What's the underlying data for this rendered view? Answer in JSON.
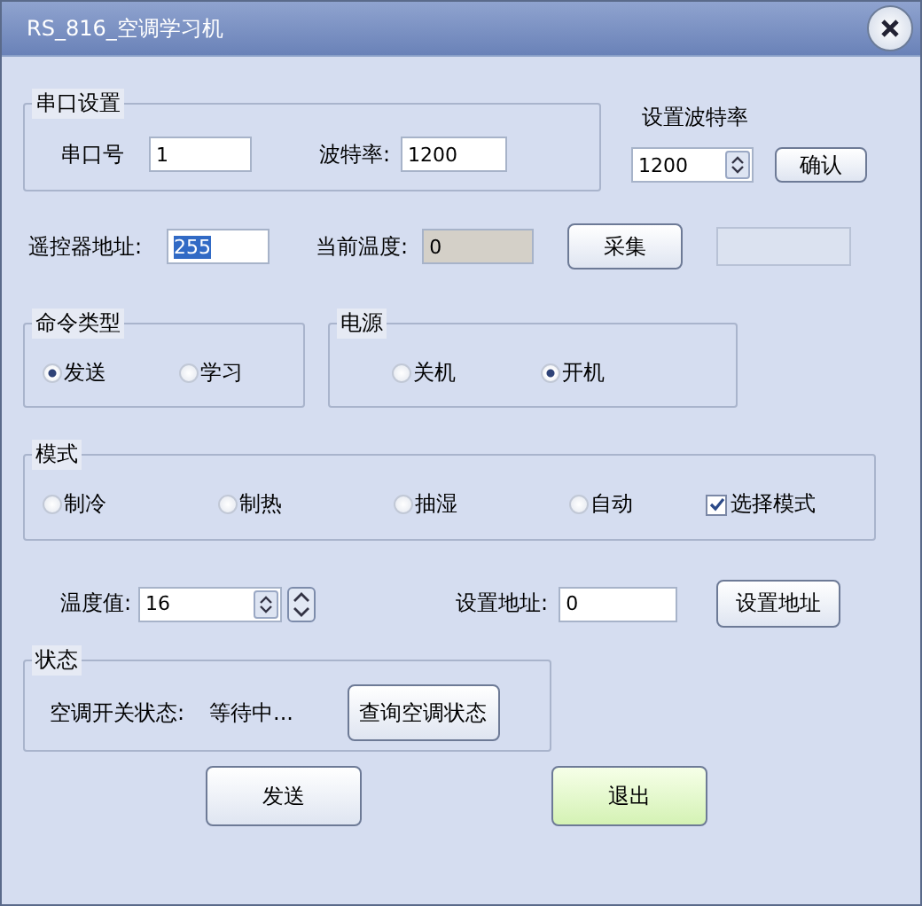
{
  "window": {
    "title": "RS_816_空调学习机"
  },
  "serial_settings": {
    "legend": "串口设置",
    "port_label": "串口号",
    "port_value": "1",
    "baud_label": "波特率:",
    "baud_value": "1200"
  },
  "baud_setting": {
    "label": "设置波特率",
    "value": "1200",
    "confirm_button": "确认"
  },
  "remote_address": {
    "label": "遥控器地址:",
    "value": "255",
    "text_selected": true
  },
  "current_temperature": {
    "label": "当前温度:",
    "value": "0"
  },
  "collect_button": "采集",
  "command_type": {
    "legend": "命令类型",
    "options": [
      {
        "label": "发送",
        "selected": true
      },
      {
        "label": "学习",
        "selected": false
      }
    ]
  },
  "power": {
    "legend": "电源",
    "options": [
      {
        "label": "关机",
        "selected": false
      },
      {
        "label": "开机",
        "selected": true
      }
    ]
  },
  "mode": {
    "legend": "模式",
    "options": [
      {
        "label": "制冷",
        "selected": false
      },
      {
        "label": "制热",
        "selected": false
      },
      {
        "label": "抽湿",
        "selected": false
      },
      {
        "label": "自动",
        "selected": false
      }
    ],
    "select_mode": {
      "label": "选择模式",
      "checked": true
    }
  },
  "temperature": {
    "label": "温度值:",
    "value": "16"
  },
  "set_address": {
    "label": "设置地址:",
    "value": "0",
    "button": "设置地址"
  },
  "status": {
    "legend": "状态",
    "label": "空调开关状态:",
    "value": "等待中...",
    "query_button": "查询空调状态"
  },
  "buttons": [
    {
      "label": "发送",
      "highlighted": false
    },
    {
      "label": "退出",
      "highlighted": true
    }
  ]
}
